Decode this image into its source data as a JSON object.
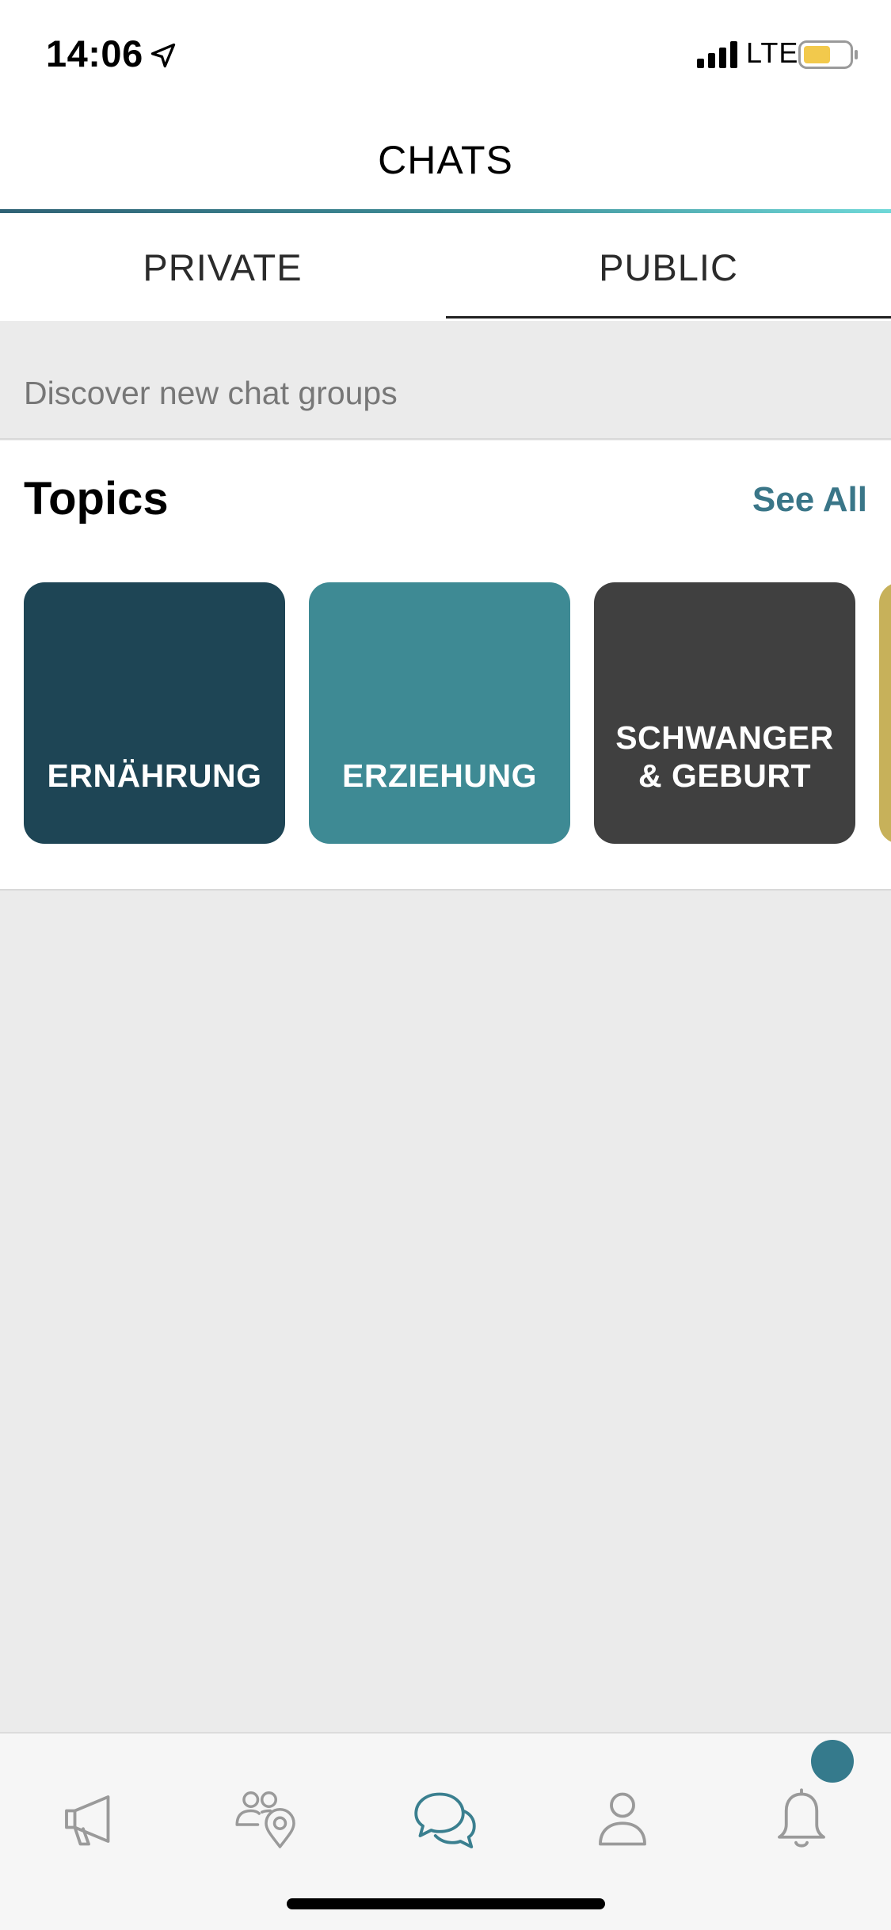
{
  "status_bar": {
    "time": "14:06",
    "network": "LTE",
    "icons": [
      "location-arrow-icon",
      "signal-bars-icon",
      "battery-icon"
    ],
    "battery_color": "#f2c94c"
  },
  "header": {
    "title": "CHATS"
  },
  "tabs": [
    {
      "label": "PRIVATE",
      "selected": false
    },
    {
      "label": "PUBLIC",
      "selected": true
    }
  ],
  "discover": {
    "text": "Discover new chat groups"
  },
  "topics": {
    "title": "Topics",
    "see_all": "See All",
    "cards": [
      {
        "label": "ERNÄHRUNG",
        "color": "#1e4555"
      },
      {
        "label": "ERZIEHUNG",
        "color": "#3e8a94"
      },
      {
        "label": "SCHWANGER\n& GEBURT",
        "color": "#404040"
      },
      {
        "label": "",
        "color": "#c7b15a"
      }
    ]
  },
  "bottom_nav": {
    "items": [
      {
        "icon": "megaphone-icon",
        "active": false
      },
      {
        "icon": "people-location-icon",
        "active": false
      },
      {
        "icon": "chat-bubbles-icon",
        "active": true
      },
      {
        "icon": "person-icon",
        "active": false
      },
      {
        "icon": "bell-icon",
        "active": false
      }
    ],
    "active_color": "#3a7f8f",
    "inactive_color": "#9a9a9a",
    "notification_dot_color": "#357a8c"
  }
}
